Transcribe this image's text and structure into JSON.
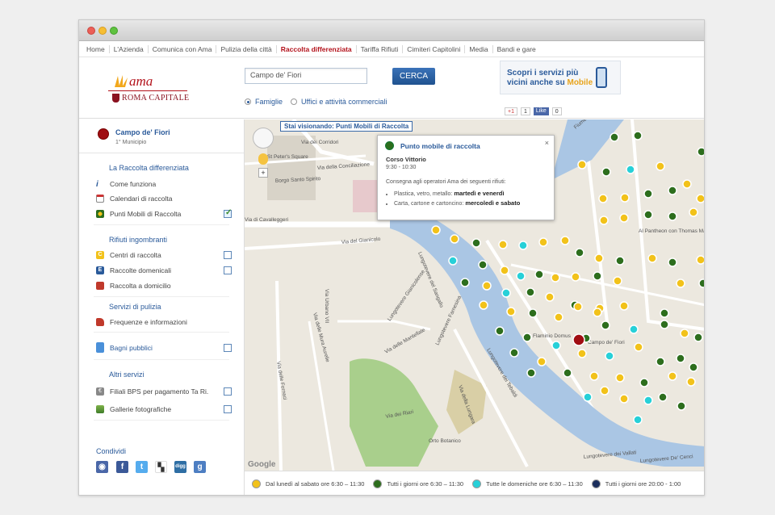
{
  "nav": [
    "Home",
    "L'Azienda",
    "Comunica con Ama",
    "Pulizia della città",
    "Raccolta differenziata",
    "Tariffa Rifiuti",
    "Cimiteri Capitolini",
    "Media",
    "Bandi e gare"
  ],
  "nav_active_index": 4,
  "logo": {
    "ama": "ama",
    "roma": "ROMA CAPITALE"
  },
  "search": {
    "value": "Campo de' Fiori",
    "button": "CERCA"
  },
  "radios": {
    "famiglie": "Famiglie",
    "uffici": "Uffici e attività commerciali"
  },
  "promo": {
    "line1": "Scopri i servizi più",
    "line2": "vicini anche su",
    "mobile": "Mobile"
  },
  "social_mini": {
    "gplus": "+1",
    "gplus_count": "1",
    "fb": "Like",
    "fb_count": "0"
  },
  "location": {
    "name": "Campo de' Fiori",
    "municipio": "1° Municipio"
  },
  "sections": {
    "raccolta": "La Raccolta differenziata",
    "come": "Come funziona",
    "calendari": "Calendari di raccolta",
    "punti": "Punti Mobili di Raccolta",
    "rifiuti": "Rifiuti ingombranti",
    "centri": "Centri di raccolta",
    "domenicali": "Raccolte domenicali",
    "domicilio": "Raccolta a domicilio",
    "servizi": "Servizi di pulizia",
    "frequenze": "Frequenze e informazioni",
    "bagni": "Bagni pubblici",
    "altri": "Altri servizi",
    "filiali": "Filiali BPS per pagamento Ta Ri.",
    "gallerie": "Gallerie fotografiche",
    "condividi": "Condividi"
  },
  "banner": "Stai visionando: Punti Mobili di Raccolta",
  "popup": {
    "title": "Punto mobile di raccolta",
    "street": "Corso Vittorio",
    "hours": "9:30 - 10:30",
    "desc": "Consegna agli operatori Ama dei seguenti rifiuti:",
    "item1": "Plastica, vetro, metallo:",
    "item1_days": "martedì e venerdì",
    "item2": "Carta, cartone e cartoncino:",
    "item2_days": "mercoledì e sabato"
  },
  "map_labels": {
    "corridori": "Via dei Corridori",
    "conciliazione": "Via della Conciliazione",
    "spirito": "Borgo Santo Spirito",
    "cavalleggeri": "Via di Cavalleggeri",
    "gianicolo": "Via del Gianicolo",
    "urbano": "Via Urbano VII",
    "sangallo": "Lungotevere del Sangallo",
    "gianicolense": "Lungotevere Gianicolense",
    "fornaci": "Via delle Fornaci",
    "mura": "Via delle Mura Aurelie",
    "martellato": "Via delle Mantellate",
    "farnesina": "Lungotevere Farnesina",
    "tebaldi": "Lungotevere dei Tebaldi",
    "lungara": "Via della Lungara",
    "riari": "Via dei Riari",
    "orto": "Orto Botanico",
    "campo": "Campo de' Fiori",
    "flaminio": "Flaminio Domus",
    "pantheon": "Al Pantheon con Thomas Mann",
    "tevere": "Fiume Tevere",
    "vallati": "Lungotevere dei Vallati",
    "cenci": "Lungotevere De' Cenci",
    "stpeter": "St Peter's Square",
    "google": "Google"
  },
  "legend": [
    {
      "label": "Dal lunedì al sabato ore 6:30 – 11:30",
      "color": "#f2c21a"
    },
    {
      "label": "Tutti i giorni ore 6:30 – 11:30",
      "color": "#2d6e1d"
    },
    {
      "label": "Tutte le domeniche ore 6:30 – 11:30",
      "color": "#27d0d8"
    },
    {
      "label": "Tutti i giorni ore 20:00 - 1:00",
      "color": "#1b2e5c"
    }
  ]
}
